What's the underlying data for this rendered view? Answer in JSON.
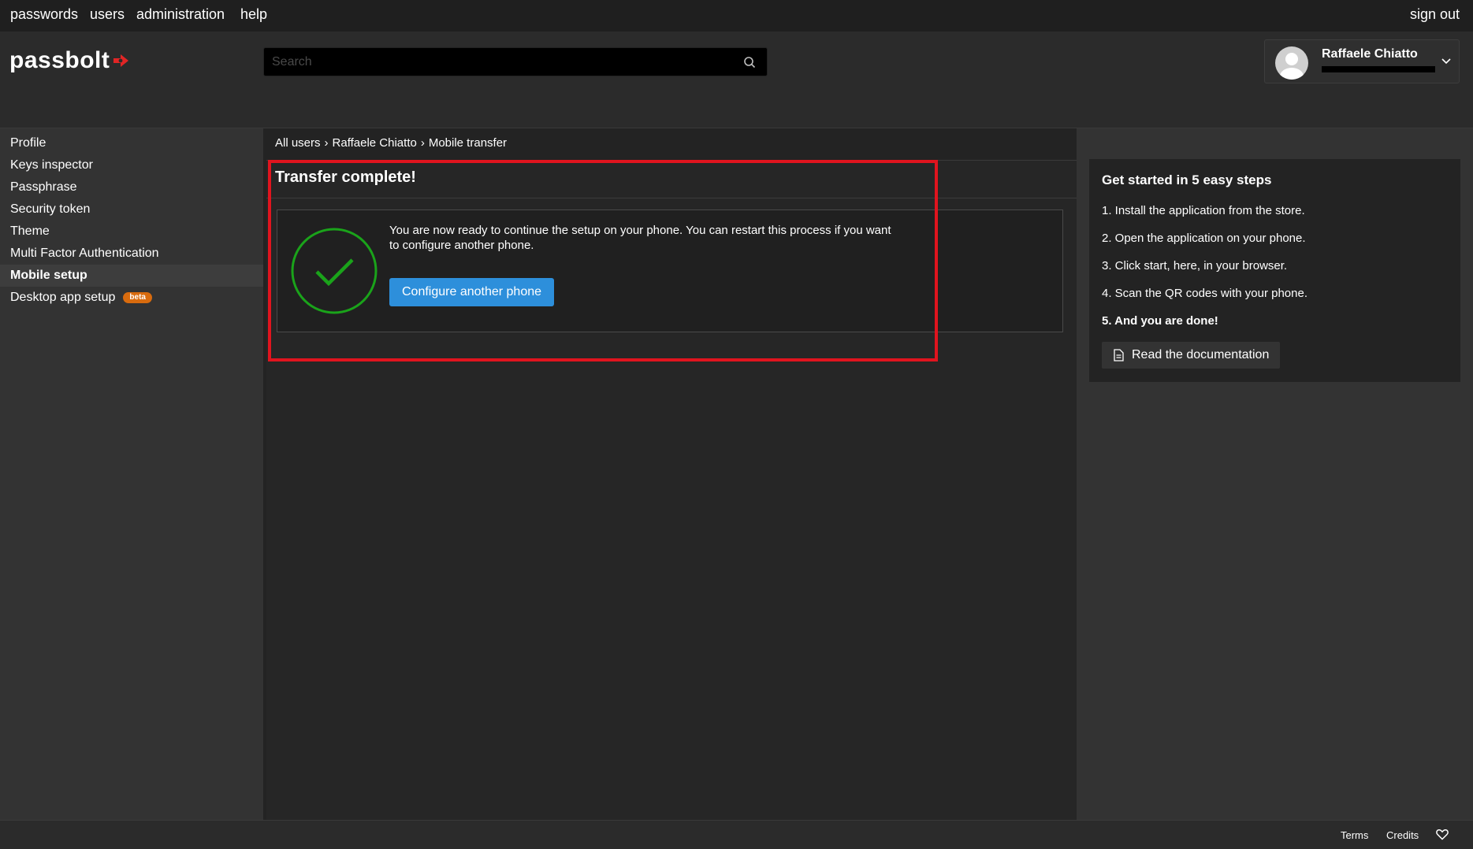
{
  "topnav": {
    "items": [
      {
        "label": "passwords"
      },
      {
        "label": "users"
      },
      {
        "label": "administration"
      },
      {
        "label": "help"
      }
    ],
    "sign_out": "sign out"
  },
  "header": {
    "logo": "passbolt",
    "search_placeholder": "Search",
    "user_name": "Raffaele Chiatto"
  },
  "sidebar": {
    "items": [
      {
        "label": "Profile"
      },
      {
        "label": "Keys inspector"
      },
      {
        "label": "Passphrase"
      },
      {
        "label": "Security token"
      },
      {
        "label": "Theme"
      },
      {
        "label": "Multi Factor Authentication"
      },
      {
        "label": "Mobile setup",
        "active": true
      },
      {
        "label": "Desktop app setup",
        "badge": "beta"
      }
    ]
  },
  "breadcrumb": {
    "items": [
      "All users",
      "Raffaele Chiatto",
      "Mobile transfer"
    ],
    "separator": "›"
  },
  "main": {
    "title": "Transfer complete!",
    "message": "You are now ready to continue the setup on your phone. You can restart this process if you want to configure another phone.",
    "button": "Configure another phone"
  },
  "help": {
    "title": "Get started in 5 easy steps",
    "steps": [
      "1. Install the application from the store.",
      "2. Open the application on your phone.",
      "3. Click start, here, in your browser.",
      "4. Scan the QR codes with your phone.",
      "5. And you are done!"
    ],
    "doc_button": "Read the documentation"
  },
  "footer": {
    "terms": "Terms",
    "credits": "Credits"
  },
  "colors": {
    "accent": "#2d8fdb",
    "success": "#1aa31a",
    "highlight": "#e0141e",
    "beta": "#d86b0e",
    "brand_red": "#e12525"
  }
}
